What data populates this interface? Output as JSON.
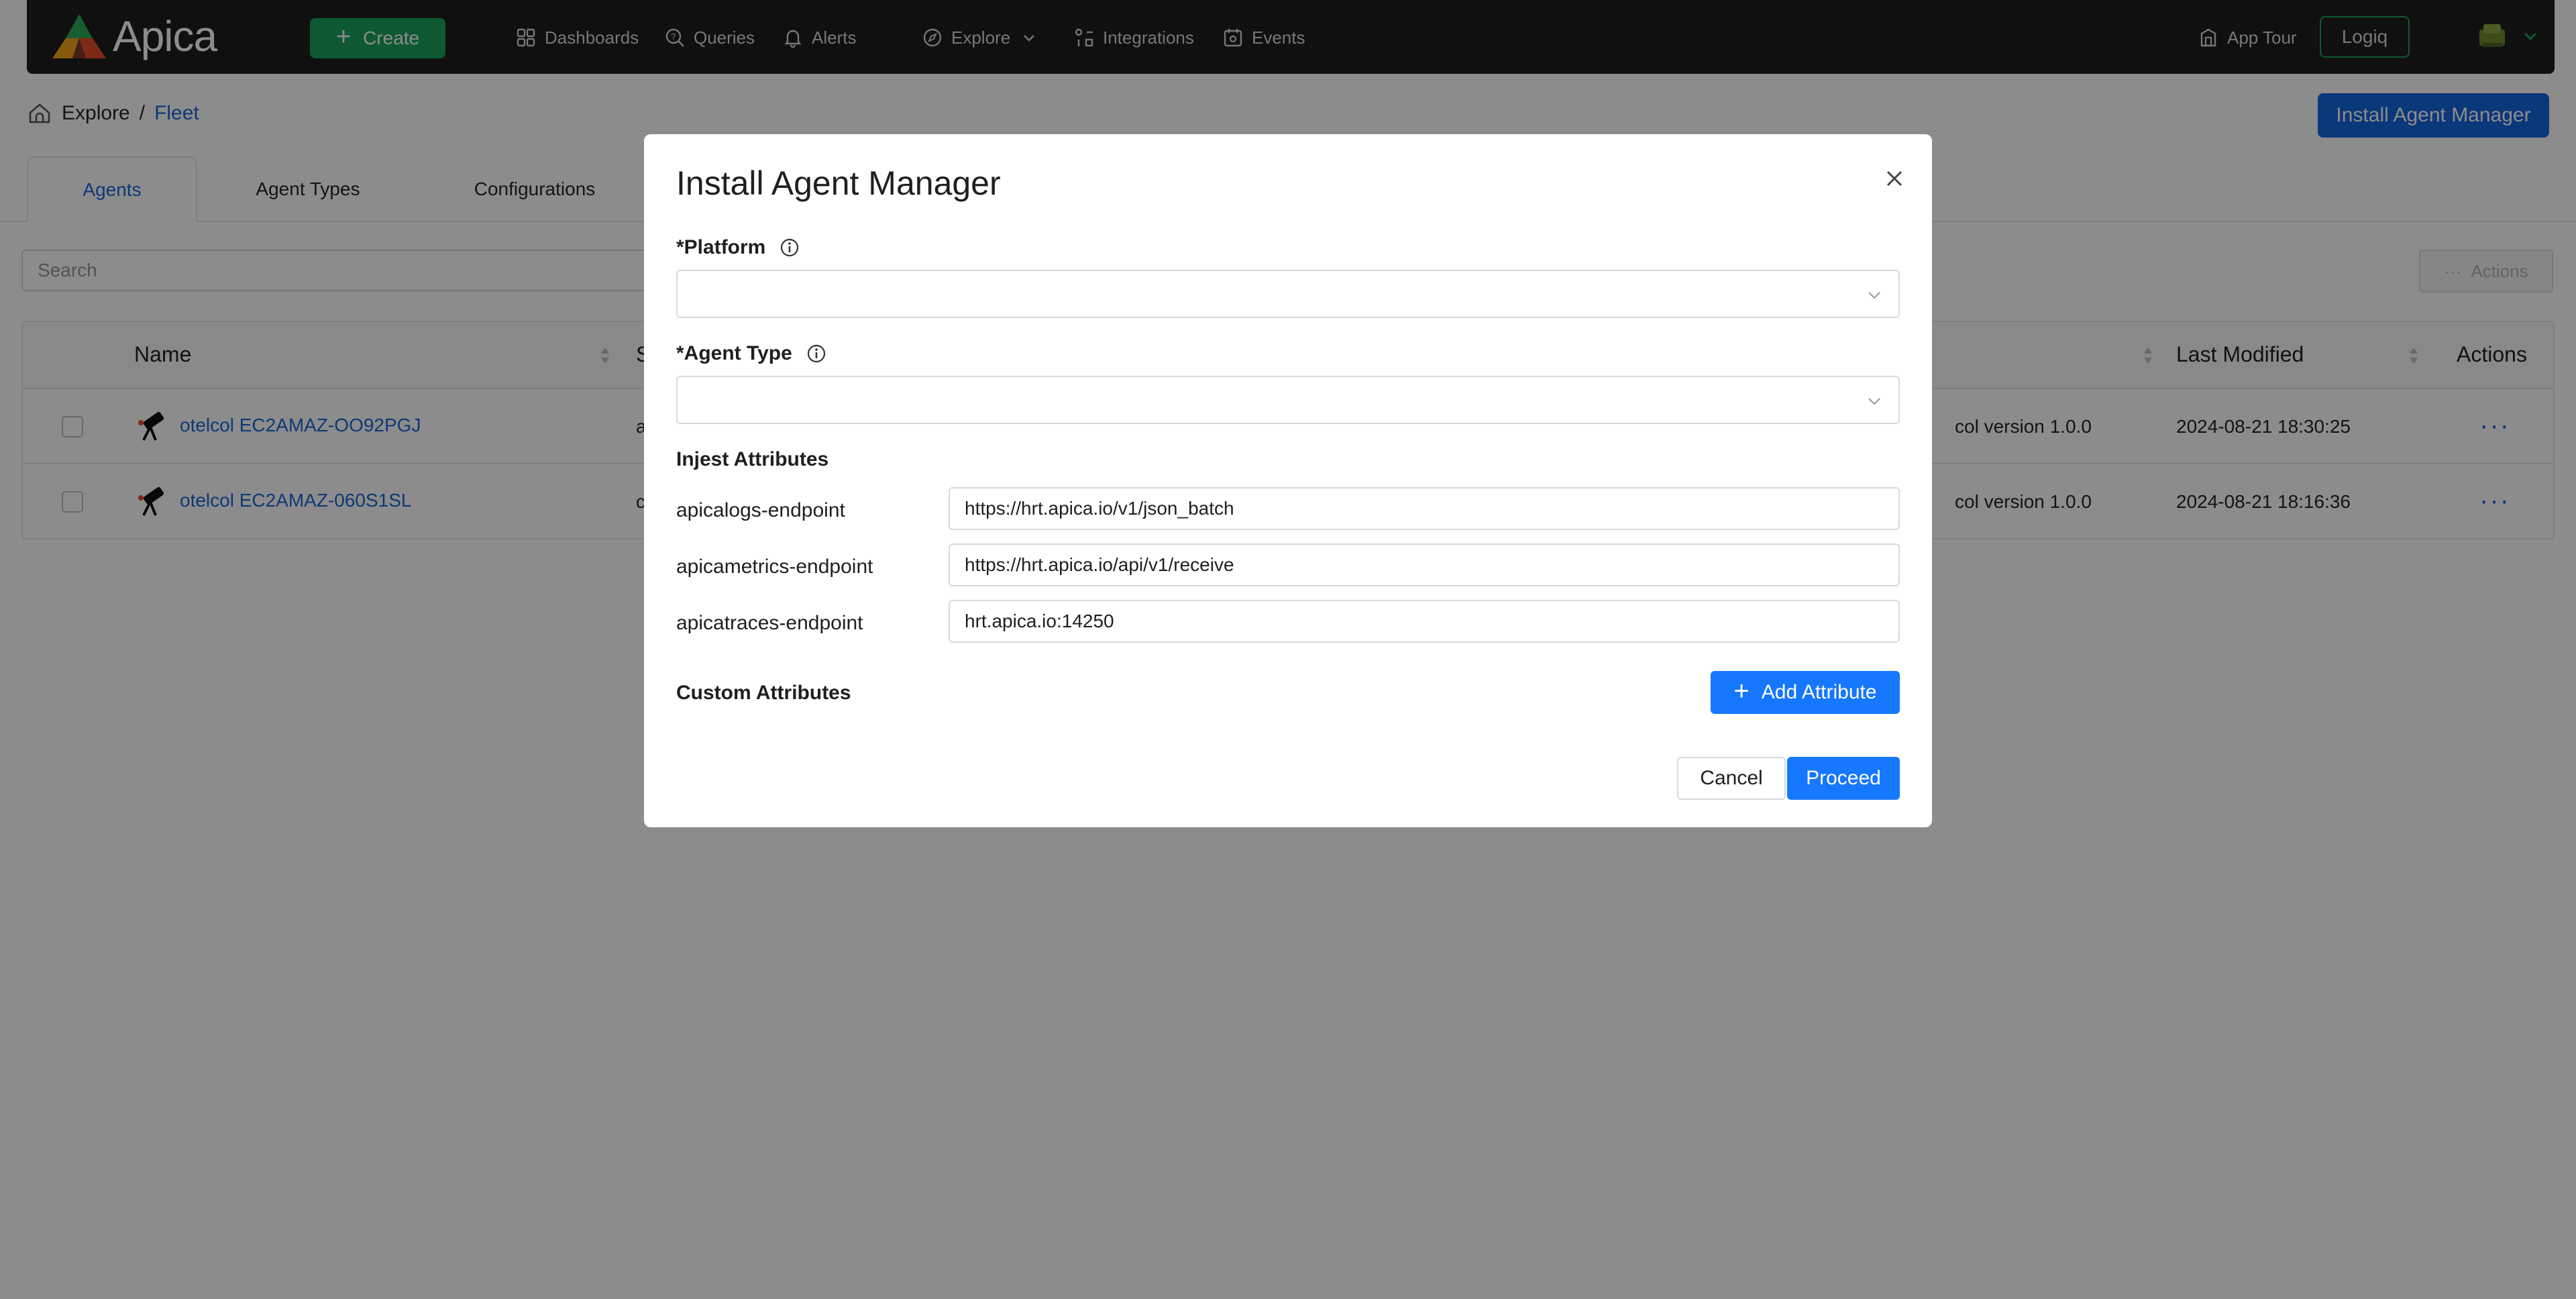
{
  "navbar": {
    "brand": "Apica",
    "create_label": "Create",
    "items": [
      {
        "label": "Dashboards",
        "icon": "dashboard-icon"
      },
      {
        "label": "Queries",
        "icon": "query-icon"
      },
      {
        "label": "Alerts",
        "icon": "bell-icon"
      },
      {
        "label": "Explore",
        "icon": "explore-icon"
      },
      {
        "label": "Integrations",
        "icon": "integrations-icon"
      },
      {
        "label": "Events",
        "icon": "events-icon"
      }
    ],
    "app_tour": "App Tour",
    "logiq": "Logiq"
  },
  "breadcrumb": {
    "root": "Explore",
    "separator": "/",
    "current": "Fleet"
  },
  "header": {
    "install_button": "Install Agent Manager"
  },
  "tabs": [
    {
      "label": "Agents",
      "active": true
    },
    {
      "label": "Agent Types",
      "active": false
    },
    {
      "label": "Configurations",
      "active": false
    }
  ],
  "search": {
    "placeholder": "Search"
  },
  "actions_label": "Actions",
  "table": {
    "columns": {
      "name": "Name",
      "status_partial": "S",
      "last_modified": "Last Modified",
      "actions": "Actions"
    },
    "rows": [
      {
        "name": "otelcol EC2AMAZ-OO92PGJ",
        "status_partial": "a",
        "version_partial": "col version 1.0.0",
        "last_modified": "2024-08-21 18:30:25"
      },
      {
        "name": "otelcol EC2AMAZ-060S1SL",
        "status_partial": "c",
        "version_partial": "col version 1.0.0",
        "last_modified": "2024-08-21 18:16:36"
      }
    ]
  },
  "modal": {
    "title": "Install Agent Manager",
    "platform_label": "*Platform",
    "agent_type_label": "*Agent Type",
    "injest_label": "Injest Attributes",
    "attributes": [
      {
        "label": "apicalogs-endpoint",
        "value": "https://hrt.apica.io/v1/json_batch"
      },
      {
        "label": "apicametrics-endpoint",
        "value": "https://hrt.apica.io/api/v1/receive"
      },
      {
        "label": "apicatraces-endpoint",
        "value": "hrt.apica.io:14250"
      }
    ],
    "custom_label": "Custom Attributes",
    "add_attribute": "Add Attribute",
    "cancel": "Cancel",
    "proceed": "Proceed"
  },
  "colors": {
    "accent": "#1677ff",
    "brand_green": "#1aa35b",
    "navbar": "#1e1e1e"
  }
}
